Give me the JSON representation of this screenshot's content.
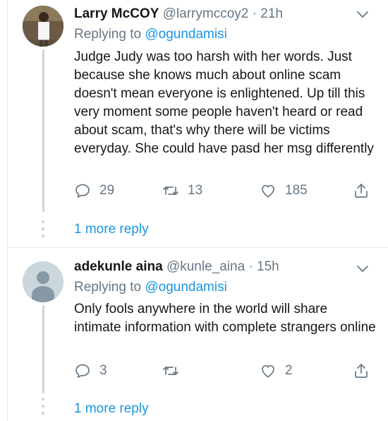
{
  "tweets": [
    {
      "name": "Larry McCOY",
      "handle": "@larrymccoy2",
      "separator": "·",
      "time": "21h",
      "replying_label": "Replying to",
      "replying_to": "@ogundamisi",
      "text": "Judge Judy was too harsh with her words. Just because she knows much about online scam doesn't mean everyone is enlightened. Up till this very moment some people haven't heard or read about scam, that's why there will be victims everyday. She could have pasd her msg differently",
      "replies": "29",
      "retweets": "13",
      "likes": "185",
      "more_replies": "1 more reply"
    },
    {
      "name": "adekunle aina",
      "handle": "@kunle_aina",
      "separator": "·",
      "time": "15h",
      "replying_label": "Replying to",
      "replying_to": "@ogundamisi",
      "text": "Only fools anywhere in the world will share intimate information with complete strangers online",
      "replies": "3",
      "retweets": "",
      "likes": "2",
      "more_replies": "1 more reply"
    }
  ],
  "colors": {
    "link": "#1b95e0",
    "secondary": "#657786",
    "thread_line": "#ccd6dd"
  }
}
